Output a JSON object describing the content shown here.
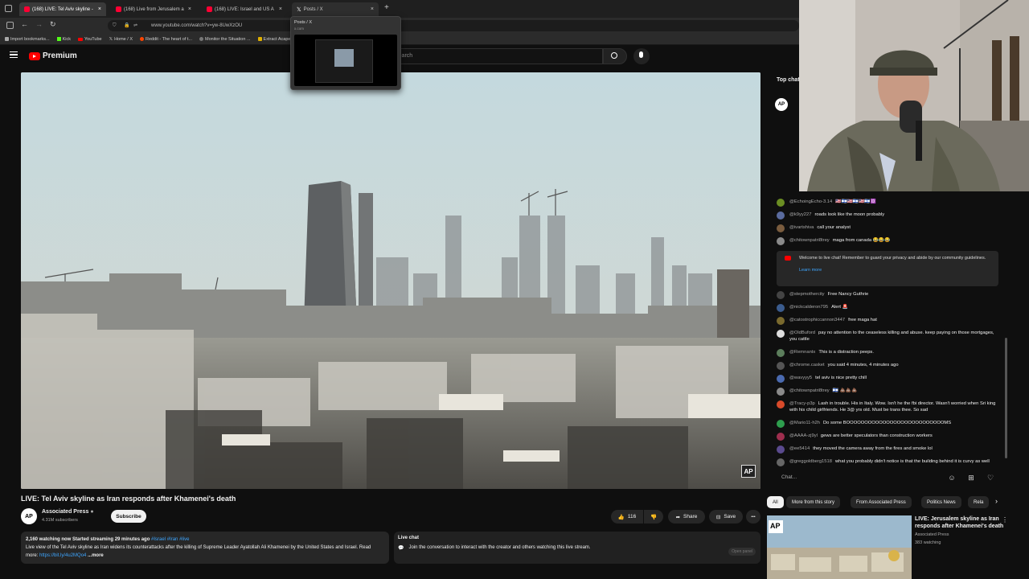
{
  "browser": {
    "tabs": [
      {
        "label": "(168) LIVE: Tel Aviv skyline - ",
        "active": true
      },
      {
        "label": "(168) Live from Jerusalem a",
        "active": false
      },
      {
        "label": "(168) LIVE: Israel and US A",
        "active": false
      },
      {
        "label": "Posts / X",
        "active": false
      }
    ],
    "new_tab": "+",
    "url": "www.youtube.com/watch?v=yw-8UwXzOU",
    "bookmarks": [
      "Import bookmarks...",
      "Kick",
      "YouTube",
      "Home / X",
      "Reddit - The heart of t...",
      "Monitor the Situation ...",
      "Extract Acapella..."
    ],
    "hover_card": {
      "title": "Posts / X",
      "domain": "x.com"
    }
  },
  "youtube": {
    "brand": "Premium",
    "search_placeholder": "Search"
  },
  "video": {
    "title": "LIVE: Tel Aviv skyline as Iran responds after Khamenei's death",
    "watermark": "AP",
    "channel": {
      "avatar": "AP",
      "name": "Associated Press",
      "subscribers": "4.31M subscribers"
    },
    "subscribe": "Subscribe",
    "likes": "116",
    "share": "Share",
    "save": "Save",
    "more": "•••",
    "description": {
      "meta": "2,160 watching now  Started streaming 29 minutes ago",
      "tags": "#Israel #Iran #live",
      "text": "Live view of the Tel Aviv skyline as Iran widens its counterattacks after the killing of Supreme Leader Ayatollah Ali Khamenei by the United States and Israel. Read more:",
      "link": "https://bit.ly/4u2MQo4",
      "more": "...more"
    },
    "live_chat_box": {
      "title": "Live chat",
      "text": "Join the conversation to interact with the creator and others watching this live stream.",
      "button": "Open panel"
    }
  },
  "chat": {
    "header": "Top chat",
    "pinned_label": "AP",
    "messages_top": [
      {
        "author": "@EchoingEcho-3.14",
        "text": "🇺🇸🇮🇱🇺🇸🇮🇱🇺🇸🇮🇱🔯",
        "color": "#6b8e23"
      },
      {
        "author": "@k9yy227",
        "text": "roads look like the moon probably",
        "color": "#5a6b9e"
      },
      {
        "author": "@ivartshiva",
        "text": "call your analyst",
        "color": "#7a5c3e"
      },
      {
        "author": "@chitownpatri8trey",
        "text": "maga from canada 😂😂😂",
        "color": "#8a8a8a"
      }
    ],
    "welcome": {
      "text": "Welcome to live chat! Remember to guard your privacy and abide by our community guidelines.",
      "link": "Learn more"
    },
    "messages": [
      {
        "author": "@stepmothercity",
        "text": "Free Nancy Guthrie",
        "color": "#444"
      },
      {
        "author": "@nickcalderon795",
        "text": "Alert 🚨",
        "color": "#3b5c8e"
      },
      {
        "author": "@catostrophiccannon3447",
        "text": "free maga hat",
        "color": "#7a6a2e"
      },
      {
        "author": "@OldBuford",
        "text": "pay no attention to the ceaseless killing and abuse. keep paying on those mortgages, you cattle",
        "color": "#ddd"
      },
      {
        "author": "@Remnantx",
        "text": "This is a distraction peeps.",
        "color": "#5c7e5c"
      },
      {
        "author": "@chrome.casket",
        "text": "you said 4 minutes, 4 minutes ago",
        "color": "#555"
      },
      {
        "author": "@wavyyy5",
        "text": "tel aviv is nice pretty chill",
        "color": "#4a6ab0"
      },
      {
        "author": "@chitownpatri8trey",
        "text": "🇮🇱 💩💩💩",
        "color": "#8a8a8a"
      },
      {
        "author": "@Tracy-p3p",
        "text": "Lash in trouble. His in Italy. Wow. Isn't he the fbi director. Wasn't worried when Sri king with his child girlfriends. He 3@ yrs old. Must be trans thee. So sad",
        "color": "#d84a2a"
      },
      {
        "author": "@Mario11-h2h",
        "text": "Do some BOOOOOOOOOOOOOOOOOOOOOOOOOOOMS",
        "color": "#2e9e4e"
      },
      {
        "author": "@AAAA-zj9yl",
        "text": "gews are better speculators than construction workers",
        "color": "#9e2e4e"
      },
      {
        "author": "@ee5414",
        "text": "they moved the camera away from the fires and smoke lol",
        "color": "#5a4a8e"
      },
      {
        "author": "@greggoldberg1518",
        "text": "what you probably didn't notice is that the building behind it is curvy as well",
        "color": "#666"
      }
    ],
    "input_placeholder": "Chat..."
  },
  "recommendations": {
    "chips": [
      "All",
      "From Associated Press",
      "From Associated Press",
      "Politics News",
      "Rela"
    ],
    "chip_labels": [
      "All",
      "More from this story",
      "From Associated Press",
      "Politics News",
      "Rela"
    ],
    "item": {
      "title": "LIVE: Jerusalem skyline as Iran responds after Khamenei's death",
      "channel": "Associated Press",
      "watching": "383 watching",
      "thumb_logo": "AP"
    }
  }
}
